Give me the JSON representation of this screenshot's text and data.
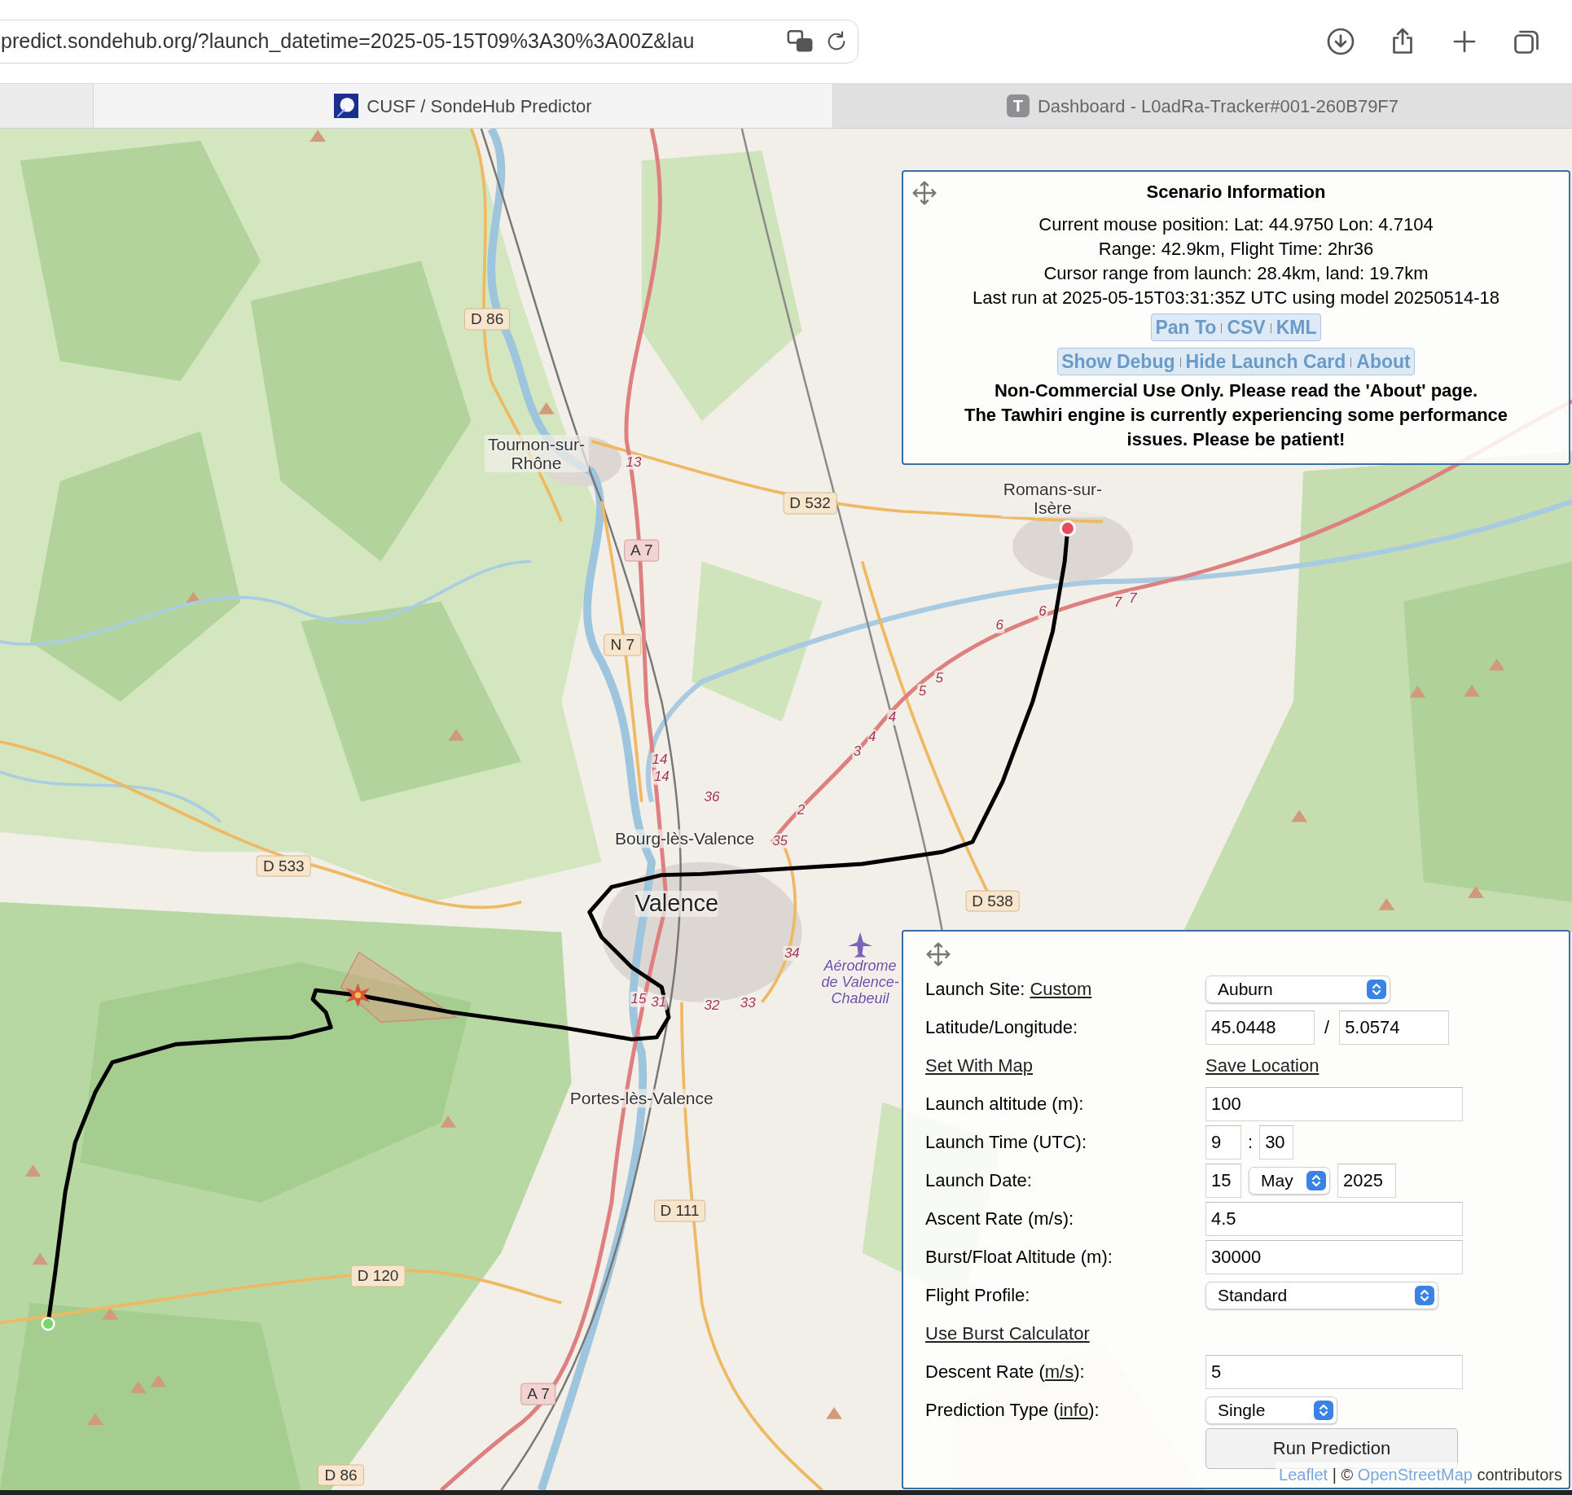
{
  "browser": {
    "url": "predict.sondehub.org/?launch_datetime=2025-05-15T09%3A30%3A00Z&lau",
    "tabs": [
      {
        "kind": "image",
        "title": "CUSF / SondeHub Predictor",
        "selected": true
      },
      {
        "kind": "letter",
        "icon_letter": "T",
        "title": "Dashboard - L0adRa-Tracker#001-260B79F7",
        "selected": false
      }
    ]
  },
  "map": {
    "labels": [
      {
        "kind": "road",
        "text": "D 86"
      },
      {
        "kind": "place",
        "text": "Tournon-sur-Rhône"
      },
      {
        "kind": "junction",
        "text": "13"
      },
      {
        "kind": "road",
        "text": "D 532"
      },
      {
        "kind": "motorway",
        "text": "A 7"
      },
      {
        "kind": "place",
        "text": "Romans-sur-Isère"
      },
      {
        "kind": "road",
        "text": "N 7"
      },
      {
        "kind": "junction",
        "text": "6"
      },
      {
        "kind": "junction",
        "text": "6"
      },
      {
        "kind": "junction",
        "text": "7"
      },
      {
        "kind": "junction",
        "text": "7"
      },
      {
        "kind": "junction",
        "text": "5"
      },
      {
        "kind": "junction",
        "text": "5"
      },
      {
        "kind": "junction",
        "text": "4"
      },
      {
        "kind": "junction",
        "text": "4"
      },
      {
        "kind": "junction",
        "text": "3"
      },
      {
        "kind": "junction",
        "text": "14"
      },
      {
        "kind": "junction",
        "text": "14"
      },
      {
        "kind": "junction",
        "text": "36"
      },
      {
        "kind": "junction",
        "text": "2"
      },
      {
        "kind": "place",
        "text": "Bourg-lès-Valence"
      },
      {
        "kind": "junction",
        "text": "35"
      },
      {
        "kind": "road",
        "text": "D 533"
      },
      {
        "kind": "road",
        "text": "D 538"
      },
      {
        "kind": "city",
        "text": "Valence"
      },
      {
        "kind": "junction",
        "text": "34"
      },
      {
        "kind": "junction",
        "text": "15"
      },
      {
        "kind": "junction",
        "text": "31"
      },
      {
        "kind": "junction",
        "text": "32"
      },
      {
        "kind": "junction",
        "text": "33"
      },
      {
        "kind": "airport",
        "text": "Aérodrome de Valence-Chabeuil"
      },
      {
        "kind": "place",
        "text": "Portes-lès-Valence"
      },
      {
        "kind": "road",
        "text": "D 111"
      },
      {
        "kind": "road",
        "text": "D 120"
      },
      {
        "kind": "motorway",
        "text": "A 7"
      },
      {
        "kind": "road",
        "text": "D 86"
      }
    ],
    "attribution": {
      "leaflet": "Leaflet",
      "separator": "|",
      "copyright": "©",
      "osm": "OpenStreetMap",
      "suffix": "contributors"
    }
  },
  "scenario": {
    "title": "Scenario Information",
    "info_lines": [
      "Current mouse position: Lat: 44.9750 Lon: 4.7104",
      "Range: 42.9km, Flight Time: 2hr36",
      "Cursor range from launch: 28.4km, land: 19.7km",
      "Last run at 2025-05-15T03:31:35Z UTC using model 20250514-18"
    ],
    "link_groups": [
      [
        "Pan To",
        "CSV",
        "KML"
      ],
      [
        "Show Debug",
        "Hide Launch Card",
        "About"
      ]
    ],
    "notices": [
      "Non-Commercial Use Only. Please read the 'About' page.",
      "The Tawhiri engine is currently experiencing some performance issues. Please be patient!"
    ]
  },
  "launch_card": {
    "rows": [
      {
        "kind": "select",
        "label": "Launch Site: ",
        "label_link": "Custom",
        "value": "Auburn"
      },
      {
        "kind": "latlon",
        "label": "Latitude/Longitude:",
        "lat": "45.0448",
        "separator": "/",
        "lon": "5.0574"
      },
      {
        "kind": "links",
        "left": "Set With Map",
        "right": "Save Location"
      },
      {
        "kind": "input",
        "label": "Launch altitude (m):",
        "value": "100"
      },
      {
        "kind": "time",
        "label": "Launch Time (UTC):",
        "hour": "9",
        "separator": ":",
        "minute": "30"
      },
      {
        "kind": "date",
        "label": "Launch Date:",
        "day": "15",
        "month": "May",
        "year": "2025"
      },
      {
        "kind": "input",
        "label": "Ascent Rate (m/s):",
        "value": "4.5"
      },
      {
        "kind": "input",
        "label": "Burst/Float Altitude (m):",
        "value": "30000"
      },
      {
        "kind": "select",
        "label": "Flight Profile:",
        "value": "Standard"
      },
      {
        "kind": "links",
        "left": "Use Burst Calculator"
      },
      {
        "kind": "input",
        "label": "Descent Rate (",
        "label_link": "m/s",
        "label_end": "):",
        "value": "5"
      },
      {
        "kind": "select",
        "label": "Prediction Type (",
        "label_link": "info",
        "label_end": "):",
        "value": "Single"
      },
      {
        "kind": "button",
        "text": "Run Prediction"
      }
    ]
  }
}
